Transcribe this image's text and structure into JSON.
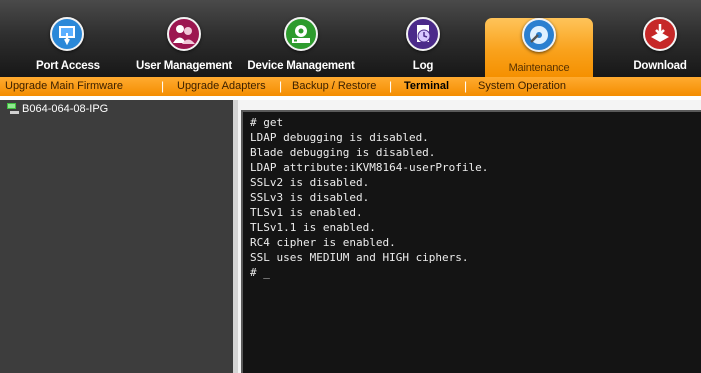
{
  "top_nav": [
    {
      "label": "Port Access",
      "icon": "port-access-icon",
      "active": false
    },
    {
      "label": "User Management",
      "icon": "users-icon",
      "active": false
    },
    {
      "label": "Device Management",
      "icon": "device-management-icon",
      "active": false
    },
    {
      "label": "Log",
      "icon": "log-clock-icon",
      "active": false
    },
    {
      "label": "Maintenance",
      "icon": "maintenance-disc-icon",
      "active": true
    },
    {
      "label": "Download",
      "icon": "download-icon",
      "active": false
    }
  ],
  "sub_nav": [
    {
      "label": "Upgrade Main Firmware",
      "active": false
    },
    {
      "label": "Upgrade Adapters",
      "active": false
    },
    {
      "label": "Backup / Restore",
      "active": false
    },
    {
      "label": "Terminal",
      "active": true
    },
    {
      "label": "System Operation",
      "active": false
    }
  ],
  "tree": {
    "device": "B064-064-08-IPG"
  },
  "terminal": {
    "lines": [
      "# get",
      "LDAP debugging is disabled.",
      "Blade debugging is disabled.",
      "LDAP attribute:iKVM8164-userProfile.",
      "SSLv2 is disabled.",
      "SSLv3 is disabled.",
      "TLSv1 is enabled.",
      "TLSv1.1 is enabled.",
      "RC4 cipher is enabled.",
      "SSL uses MEDIUM and HIGH ciphers.",
      "# _"
    ]
  },
  "colors": {
    "accent_orange": "#f9a21c",
    "topbar_dark": "#2f2f2f",
    "panel_dark": "#3d3d3d",
    "terminal_bg": "#141414"
  }
}
